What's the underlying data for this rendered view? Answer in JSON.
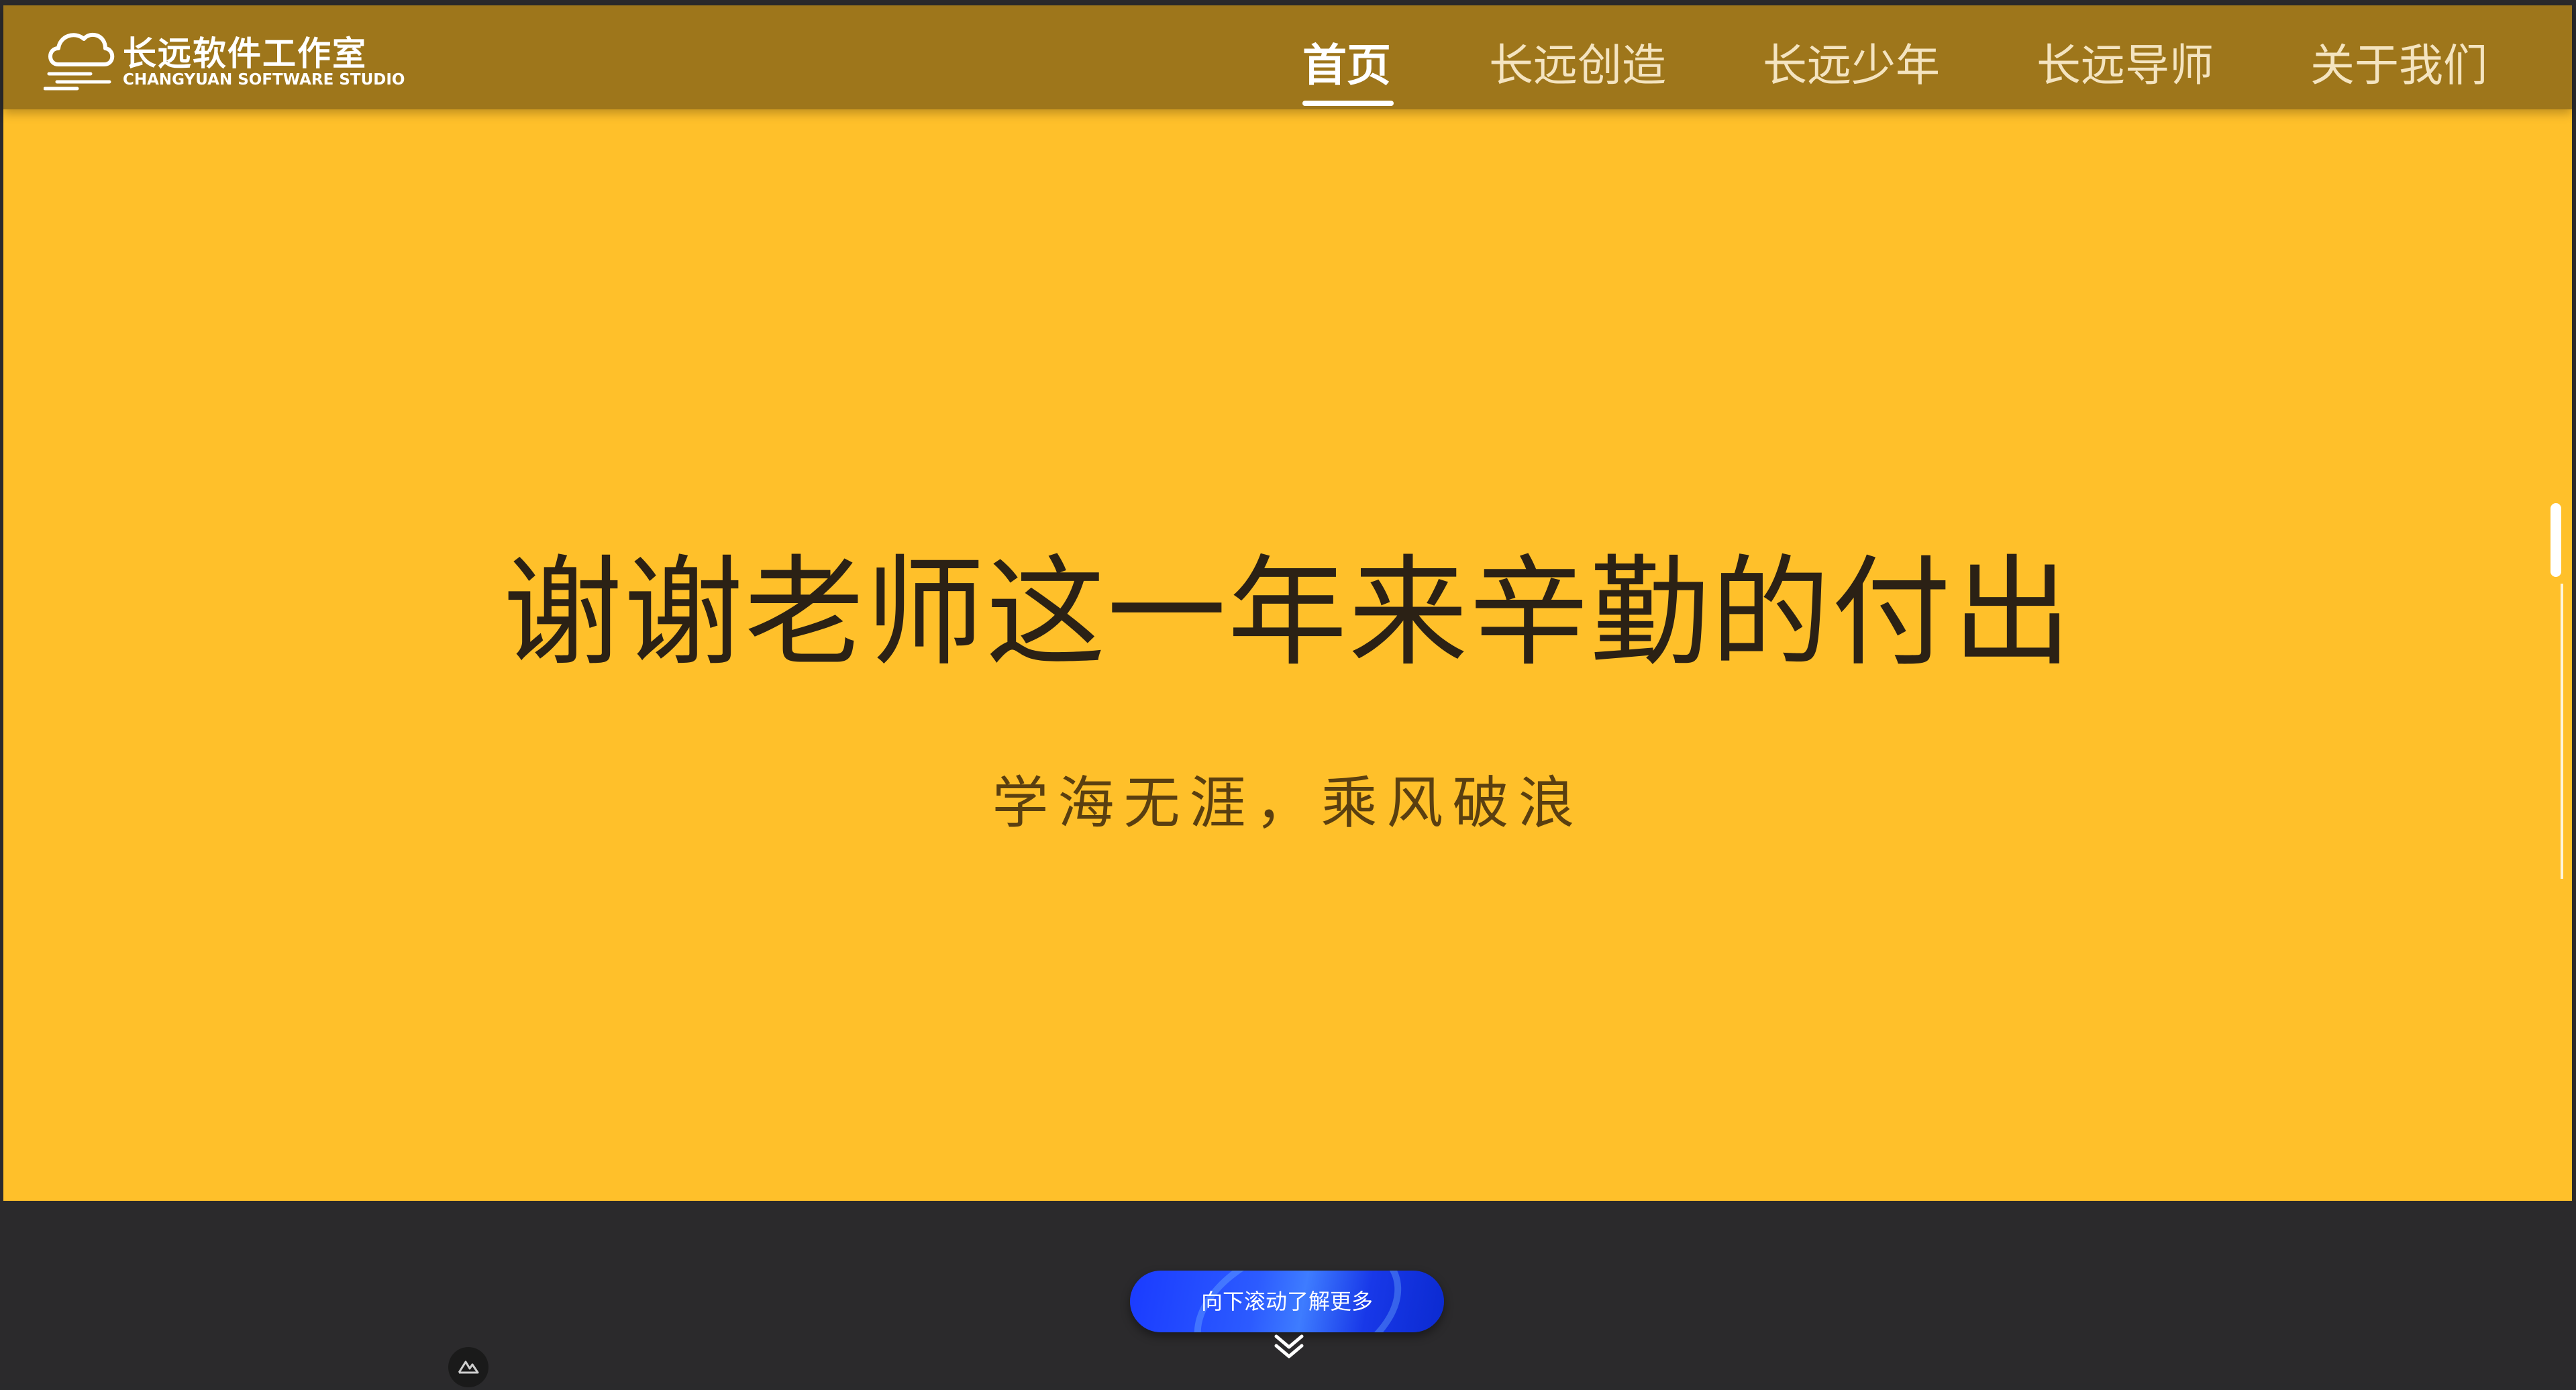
{
  "brand": {
    "name": "长远软件工作室",
    "subtitle": "CHANGYUAN SOFTWARE STUDIO",
    "icon": "cloud-icon"
  },
  "nav": [
    {
      "label": "首页",
      "active": true
    },
    {
      "label": "长远创造",
      "active": false
    },
    {
      "label": "长远少年",
      "active": false
    },
    {
      "label": "长远导师",
      "active": false
    },
    {
      "label": "关于我们",
      "active": false
    }
  ],
  "hero": {
    "title": "谢谢老师这一年来辛勤的付出",
    "subtitle": "学海无涯，乘风破浪"
  },
  "scroll_button": {
    "label": "向下滚动了解更多",
    "icon": "chevron-double-down-icon"
  },
  "colors": {
    "hero_bg": "#ffc02a",
    "navbar_bg": "#9e761b",
    "footer_bg": "#2b2a2c",
    "button": "#1a3bff"
  }
}
